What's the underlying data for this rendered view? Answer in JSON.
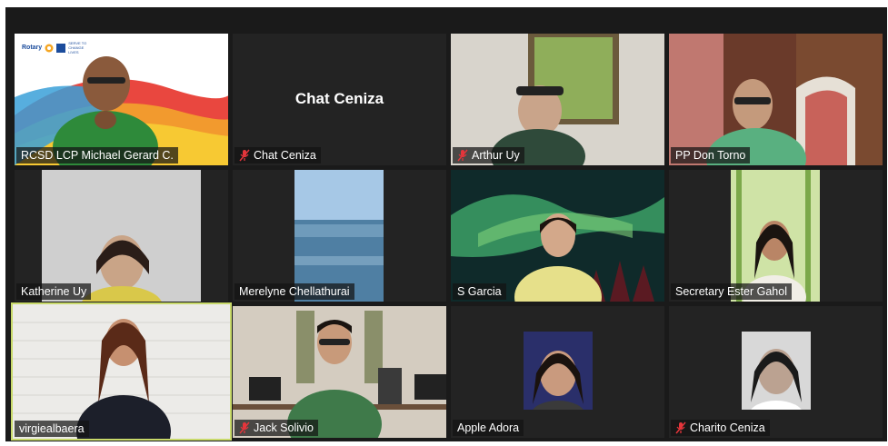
{
  "participants": [
    {
      "name": "RCSD LCP Michael Gerard C.",
      "muted": false,
      "video": "rotary-background",
      "rotary_logo": "Rotary",
      "rotary_tagline": "SERVE TO CHANGE LIVES"
    },
    {
      "name": "Chat Ceniza",
      "muted": true,
      "video": "off",
      "display_name": "Chat Ceniza"
    },
    {
      "name": "Arthur Uy",
      "muted": true,
      "video": "home"
    },
    {
      "name": "PP Don Torno",
      "muted": false,
      "video": "home"
    },
    {
      "name": "Katherine Uy",
      "muted": false,
      "video": "plain-wall"
    },
    {
      "name": "Merelyne Chellathurai",
      "muted": false,
      "video": "sea-background"
    },
    {
      "name": "S Garcia",
      "muted": false,
      "video": "aurora-background"
    },
    {
      "name": "Secretary Ester Gahol",
      "muted": false,
      "video": "bamboo-background"
    },
    {
      "name": "virgiealbaera",
      "muted": false,
      "video": "brick-wall",
      "active_speaker": true
    },
    {
      "name": "Jack Solivio",
      "muted": true,
      "video": "office"
    },
    {
      "name": "Apple Adora",
      "muted": false,
      "video": "photo"
    },
    {
      "name": "Charito Ceniza",
      "muted": true,
      "video": "photo"
    }
  ],
  "colors": {
    "gallery_bg": "#1a1a1a",
    "tile_bg": "#232323",
    "active_border": "#c8d96a",
    "mute_icon": "#e5353b"
  }
}
